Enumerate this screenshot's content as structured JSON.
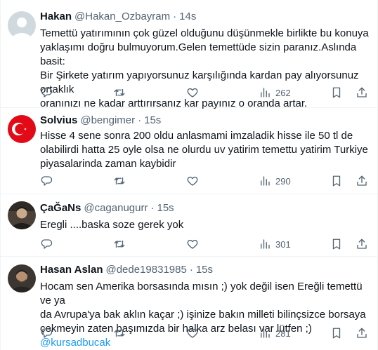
{
  "tweets": [
    {
      "name": "Hakan",
      "handle": "@Hakan_Ozbayram",
      "dot": "·",
      "time": "14s",
      "text": "Temettü yatırımının çok güzel olduğunu düşünmekle birlikte bu konuya\nyaklaşımı doğru bulmuyorum.Gelen temettüde sizin paranız.Aslında basit:\nBir Şirkete yatırım yapıyorsunuz karşılığında kardan pay alıyorsunuz ortaklık\noranınızı ne kadar arttırırsanız kar payınız o oranda artar.",
      "mention": "",
      "views": "262",
      "avatar": "default-avatar-icon"
    },
    {
      "name": "Solvius",
      "handle": "@bengimer",
      "dot": "·",
      "time": "15s",
      "text": "Hisse  4 sene sonra 200 oldu anlasmami imzaladik hisse ile 50 tl de\nolabilirdi hatta 25 oyle olsa ne olurdu uv yatirim temettu yatirim  Turkiye\npiyasalarinda zaman kaybidir",
      "mention": "",
      "views": "290",
      "avatar": "turkish-flag-icon"
    },
    {
      "name": "ÇaĞaNs",
      "handle": "@caganugurr",
      "dot": "·",
      "time": "15s",
      "text": "Eregli ....baska soze gerek yok",
      "mention": "",
      "views": "301",
      "avatar": "user-photo-avatar"
    },
    {
      "name": "Hasan Aslan",
      "handle": "@dede19831985",
      "dot": "·",
      "time": "15s",
      "text": "Hocam sen Amerika borsasında mısın ;) yok değil isen Ereğli temettü ve ya\nda Avrupa'ya bak aklın kaçar ;) işinize bakın milleti bilinçsizce borsaya\nçekmeyin zaten başımızda bir halka arz belası var lütfen ;) ",
      "mention": "@kursadbucak",
      "views": "281",
      "avatar": "user-photo-avatar"
    }
  ],
  "icons": {
    "reply": "reply-icon",
    "retweet": "retweet-icon",
    "like": "like-icon",
    "views": "views-icon",
    "bookmark": "bookmark-icon",
    "share": "share-icon"
  },
  "colors": {
    "text": "#0f1419",
    "secondary": "#536471",
    "link": "#1d9bf0",
    "border": "#eff3f4",
    "flag_red": "#e30a17"
  }
}
